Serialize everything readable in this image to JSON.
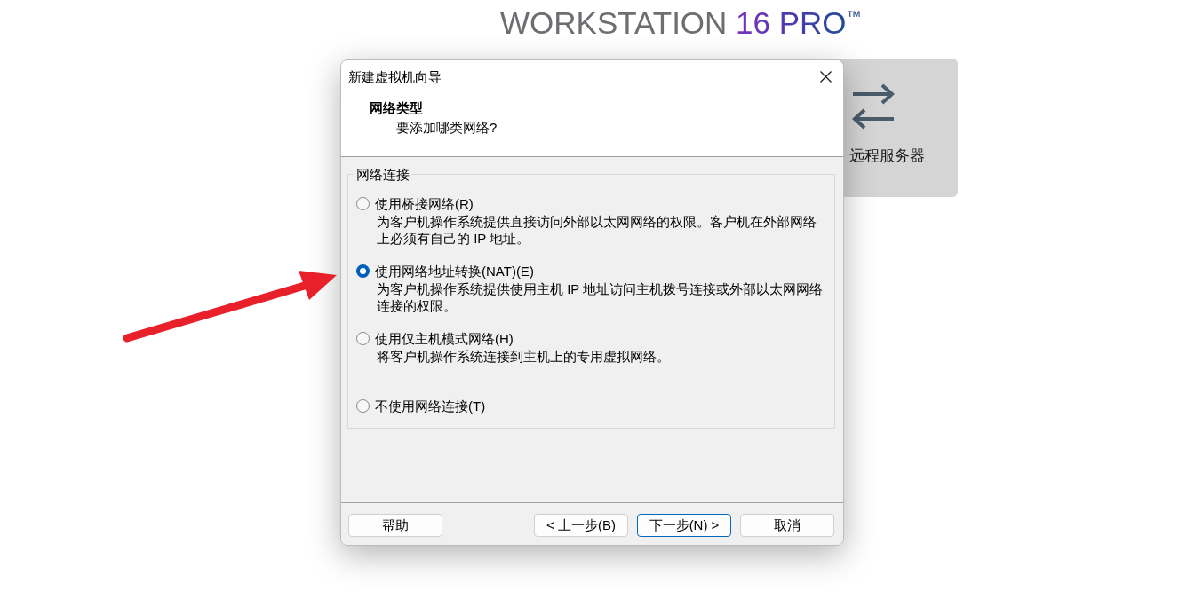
{
  "product_title": {
    "name": "WORKSTATION",
    "edition": "16 PRO",
    "mark": "™"
  },
  "background_card": {
    "label": "远程服务器"
  },
  "dialog": {
    "title": "新建虚拟机向导",
    "heading": "网络类型",
    "subheading": "要添加哪类网络?",
    "group": {
      "label": "网络连接",
      "options": [
        {
          "label": "使用桥接网络(R)",
          "description": "为客户机操作系统提供直接访问外部以太网网络的权限。客户机在外部网络上必须有自己的 IP 地址。",
          "selected": false
        },
        {
          "label": "使用网络地址转换(NAT)(E)",
          "description": "为客户机操作系统提供使用主机 IP 地址访问主机拨号连接或外部以太网网络连接的权限。",
          "selected": true
        },
        {
          "label": "使用仅主机模式网络(H)",
          "description": "将客户机操作系统连接到主机上的专用虚拟网络。",
          "selected": false
        },
        {
          "label": "不使用网络连接(T)",
          "selected": false
        }
      ]
    },
    "help_button": "帮助",
    "buttons": [
      {
        "label": "< 上一步(B)",
        "default": false
      },
      {
        "label": "下一步(N) >",
        "default": true
      },
      {
        "label": "取消",
        "default": false
      }
    ]
  }
}
